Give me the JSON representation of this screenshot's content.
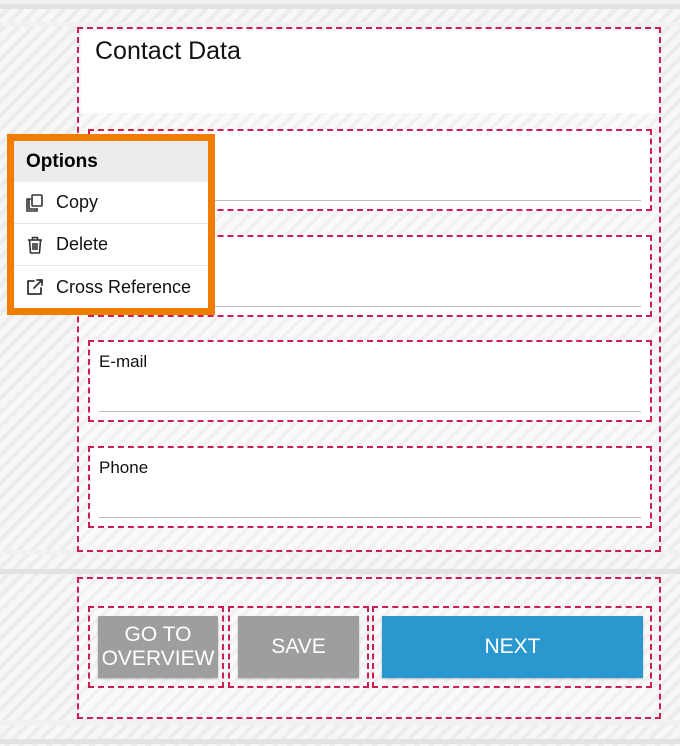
{
  "form": {
    "title": "Contact Data",
    "fields": [
      {
        "label": "",
        "value": ""
      },
      {
        "label": "",
        "value": ""
      },
      {
        "label": "E-mail",
        "value": ""
      },
      {
        "label": "Phone",
        "value": ""
      }
    ]
  },
  "buttons": {
    "overview": "GO TO\nOVERVIEW",
    "save": "SAVE",
    "next": "NEXT"
  },
  "options_menu": {
    "title": "Options",
    "items": [
      {
        "label": "Copy",
        "icon": "copy-icon"
      },
      {
        "label": "Delete",
        "icon": "trash-icon"
      },
      {
        "label": "Cross Reference",
        "icon": "external-link-icon"
      }
    ]
  },
  "colors": {
    "dashed_border": "#cc1f4f",
    "popup_border": "#f07d00",
    "primary_button": "#2b97cf",
    "secondary_button": "#9e9e9e"
  }
}
